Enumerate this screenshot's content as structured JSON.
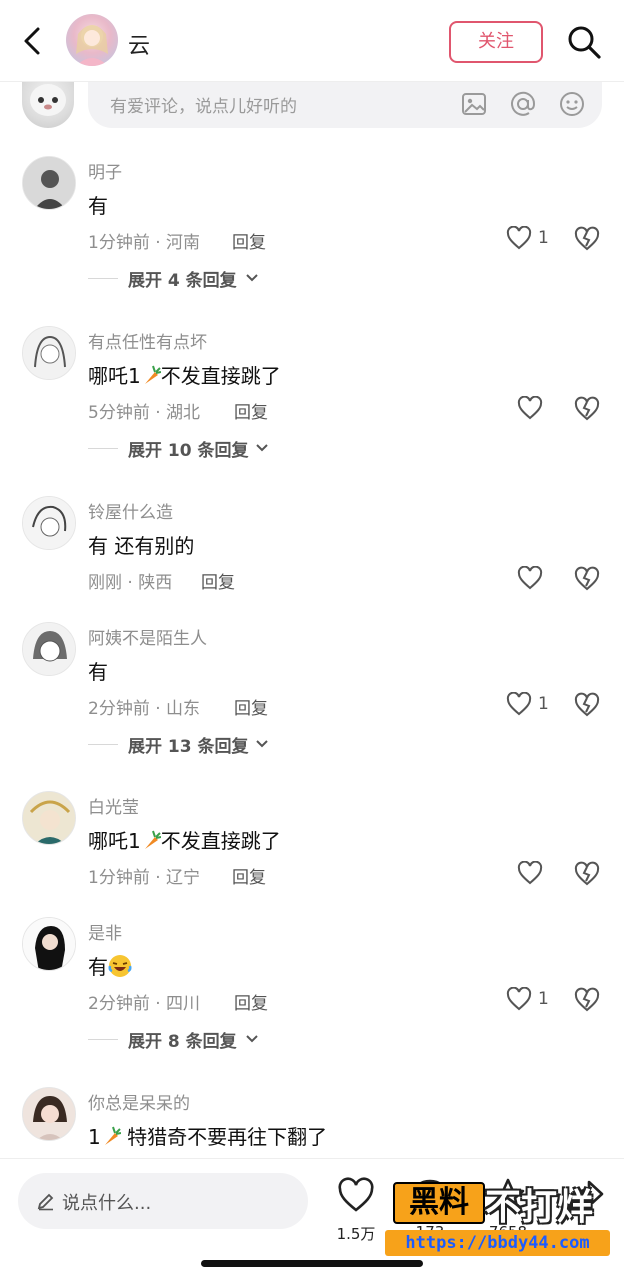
{
  "header": {
    "name": "云",
    "follow_label": "关注"
  },
  "comment_input": {
    "placeholder": "有爱评论，说点儿好听的"
  },
  "comments": [
    {
      "user": "明子",
      "text": "有",
      "meta": "1分钟前 · 河南",
      "reply_label": "回复",
      "likes": "1",
      "expand": "展开 4 条回复"
    },
    {
      "user": "有点任性有点坏",
      "text_before": "哪吒1",
      "text_after": "不发直接跳了",
      "meta": "5分钟前 · 湖北",
      "reply_label": "回复",
      "likes": "",
      "expand": "展开 10 条回复"
    },
    {
      "user": "铃屋什么造",
      "text": "有 还有别的",
      "meta": "刚刚 · 陕西",
      "reply_label": "回复",
      "likes": ""
    },
    {
      "user": "阿姨不是陌生人",
      "text": "有",
      "meta": "2分钟前 · 山东",
      "reply_label": "回复",
      "likes": "1",
      "expand": "展开 13 条回复"
    },
    {
      "user": "白光莹",
      "text_before": "哪吒1",
      "text_after": "不发直接跳了",
      "meta": "1分钟前 · 辽宁",
      "reply_label": "回复",
      "likes": ""
    },
    {
      "user": "是非",
      "text": "有",
      "meta": "2分钟前 · 四川",
      "reply_label": "回复",
      "likes": "1",
      "expand": "展开 8 条回复"
    },
    {
      "user": "你总是呆呆的",
      "text_before": "1",
      "text_after": " 特猎奇不要再往下翻了"
    }
  ],
  "bottom_bar": {
    "placeholder": "说点什么...",
    "like_count": "1.5万",
    "comment_count": "173",
    "star_count": "7658"
  },
  "watermark": {
    "logo": "黑料",
    "text": "不打烊",
    "url": "https://bbdy44.com"
  },
  "colors": {
    "accent": "#e0566e",
    "watermark_orange": "#f7a21a",
    "watermark_url": "#1b5cff"
  }
}
